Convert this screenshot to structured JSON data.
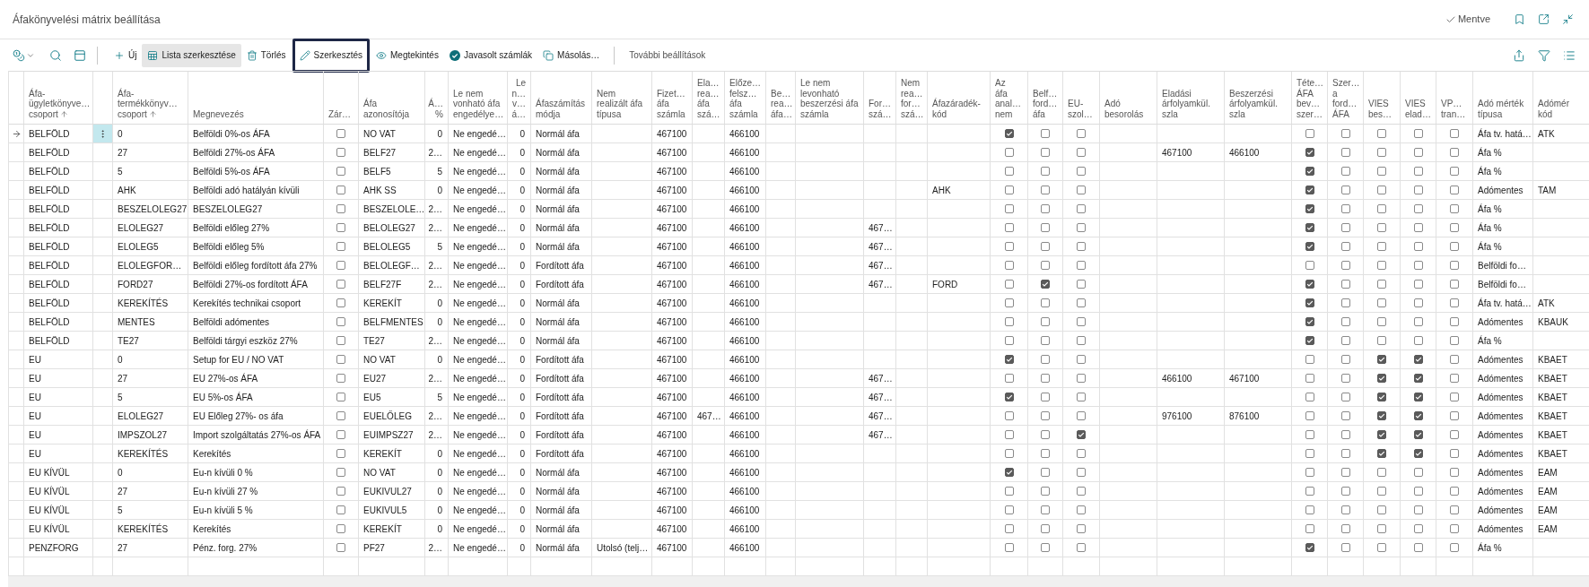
{
  "page": {
    "title": "Áfakönyvelési mátrix beállítása",
    "save_status": "Mentve"
  },
  "toolbar": {
    "actions": [
      {
        "label": "Új",
        "active": false,
        "focused": false
      },
      {
        "label": "Lista szerkesztése",
        "active": true,
        "focused": false
      },
      {
        "label": "Törlés",
        "active": false,
        "focused": false
      },
      {
        "label": "Szerkesztés",
        "active": false,
        "focused": true
      },
      {
        "label": "Megtekintés",
        "active": false,
        "focused": false
      },
      {
        "label": "Javasolt számlák",
        "active": false,
        "focused": false
      },
      {
        "label": "Másolás…",
        "active": false,
        "focused": false
      }
    ],
    "more": "További beállítások"
  },
  "table": {
    "columns": [
      {
        "label": "Áfa-\nügyletkönyve…\ncsoport",
        "kind": "text",
        "sorted": true
      },
      {
        "label": "Áfa-\ntermékkönyv…\ncsoport",
        "kind": "text",
        "sorted": true
      },
      {
        "label": "Megnevezés",
        "kind": "text",
        "sorted": false
      },
      {
        "label": "Zár…",
        "kind": "check",
        "sorted": false
      },
      {
        "label": "Áfa\nazonosítója",
        "kind": "text",
        "sorted": false
      },
      {
        "label": "Á…\n%",
        "kind": "number",
        "sorted": false
      },
      {
        "label": "Le nem\nvonható áfa\nengedélye…",
        "kind": "text",
        "sorted": false
      },
      {
        "label": "Le\nn…\nv…\ná…",
        "kind": "number",
        "sorted": false
      },
      {
        "label": "Áfaszámítás\nmódja",
        "kind": "text",
        "sorted": false
      },
      {
        "label": "Nem\nrealizált áfa\ntípusa",
        "kind": "text",
        "sorted": false
      },
      {
        "label": "Fizet…\náfa\nszámla",
        "kind": "text",
        "sorted": false
      },
      {
        "label": "Ela…\nrea…\náfa\nszá…",
        "kind": "text",
        "sorted": false
      },
      {
        "label": "Előze…\nfelsz…\náfa\nszámla",
        "kind": "text",
        "sorted": false
      },
      {
        "label": "Be…\nrea…\náfa…",
        "kind": "text",
        "sorted": false
      },
      {
        "label": "Le nem\nlevonható\nbeszerzési áfa\nszámla",
        "kind": "text",
        "sorted": false
      },
      {
        "label": "For…\nszá…",
        "kind": "text",
        "sorted": false
      },
      {
        "label": "Nem\nrea…\nfor…\nszá…",
        "kind": "text",
        "sorted": false
      },
      {
        "label": "Áfazáradék-\nkód",
        "kind": "text",
        "sorted": false
      },
      {
        "label": "Az\náfa\nanal…\nnem",
        "kind": "check",
        "sorted": false
      },
      {
        "label": "Belf…\nford…\náfa",
        "kind": "check",
        "sorted": false
      },
      {
        "label": "EU-\nszol…",
        "kind": "check",
        "sorted": false
      },
      {
        "label": "Adó\nbesorolás",
        "kind": "text",
        "sorted": false
      },
      {
        "label": "Eladási\nárfolyamkül.\nszla",
        "kind": "text",
        "sorted": false
      },
      {
        "label": "Beszerzési\nárfolyamkül.\nszla",
        "kind": "text",
        "sorted": false
      },
      {
        "label": "Téte…\nÁFA\nbev…\nszer…",
        "kind": "check",
        "sorted": false
      },
      {
        "label": "Szer…\na\nford…\nÁFA",
        "kind": "check",
        "sorted": false
      },
      {
        "label": "VIES\nbes…",
        "kind": "check",
        "sorted": false
      },
      {
        "label": "VIES\nelad…",
        "kind": "check",
        "sorted": false
      },
      {
        "label": "VP…\ntran…",
        "kind": "check",
        "sorted": false
      },
      {
        "label": "Adó mérték\ntípusa",
        "kind": "text",
        "sorted": false
      },
      {
        "label": "Adómér\nkód",
        "kind": "text",
        "sorted": false
      }
    ],
    "rows": [
      {
        "selected": true,
        "cells": [
          "BELFÖLD",
          "0",
          "Belföldi 0%-os ÁFA",
          false,
          "NO VAT",
          "0",
          "Ne engedé…",
          "0",
          "Normál áfa",
          null,
          "467100",
          null,
          "466100",
          null,
          null,
          null,
          null,
          null,
          true,
          false,
          false,
          null,
          null,
          null,
          false,
          false,
          false,
          false,
          false,
          "Áfa tv. hatá…",
          "ATK"
        ]
      },
      {
        "selected": false,
        "cells": [
          "BELFÖLD",
          "27",
          "Belföldi 27%-os ÁFA",
          false,
          "BELF27",
          "2…",
          "Ne engedé…",
          "0",
          "Normál áfa",
          null,
          "467100",
          null,
          "466100",
          null,
          null,
          null,
          null,
          null,
          false,
          false,
          false,
          null,
          "467100",
          "466100",
          true,
          false,
          false,
          false,
          false,
          "Áfa %",
          null
        ]
      },
      {
        "selected": false,
        "cells": [
          "BELFÖLD",
          "5",
          "Belföldi 5%-os ÁFA",
          false,
          "BELF5",
          "5",
          "Ne engedé…",
          "0",
          "Normál áfa",
          null,
          "467100",
          null,
          "466100",
          null,
          null,
          null,
          null,
          null,
          false,
          false,
          false,
          null,
          null,
          null,
          true,
          false,
          false,
          false,
          false,
          "Áfa %",
          null
        ]
      },
      {
        "selected": false,
        "cells": [
          "BELFÖLD",
          "AHK",
          "Belföldi adó hatályán kívüli",
          false,
          "AHK SS",
          "0",
          "Ne engedé…",
          "0",
          "Normál áfa",
          null,
          "467100",
          null,
          "466100",
          null,
          null,
          null,
          null,
          "AHK",
          false,
          false,
          false,
          null,
          null,
          null,
          true,
          false,
          false,
          false,
          false,
          "Adómentes",
          "TAM"
        ]
      },
      {
        "selected": false,
        "cells": [
          "BELFÖLD",
          "BESZELOLEG27",
          "BESZELOLEG27",
          false,
          "BESZELOLE…",
          "2…",
          "Ne engedé…",
          "0",
          "Normál áfa",
          null,
          "467100",
          null,
          "466100",
          null,
          null,
          null,
          null,
          null,
          false,
          false,
          false,
          null,
          null,
          null,
          true,
          false,
          false,
          false,
          false,
          "Áfa %",
          null
        ]
      },
      {
        "selected": false,
        "cells": [
          "BELFÖLD",
          "ELOLEG27",
          "Belföldi előleg 27%",
          false,
          "BELOLEG27",
          "2…",
          "Ne engedé…",
          "0",
          "Normál áfa",
          null,
          "467100",
          null,
          "466100",
          null,
          null,
          "467…",
          null,
          null,
          false,
          false,
          false,
          null,
          null,
          null,
          true,
          false,
          false,
          false,
          false,
          "Áfa %",
          null
        ]
      },
      {
        "selected": false,
        "cells": [
          "BELFÖLD",
          "ELOLEG5",
          "Belföldi előleg 5%",
          false,
          "BELOLEG5",
          "5",
          "Ne engedé…",
          "0",
          "Normál áfa",
          null,
          "467100",
          null,
          "466100",
          null,
          null,
          "467…",
          null,
          null,
          false,
          false,
          false,
          null,
          null,
          null,
          true,
          false,
          false,
          false,
          false,
          "Áfa %",
          null
        ]
      },
      {
        "selected": false,
        "cells": [
          "BELFÖLD",
          "ELOLEGFOR…",
          "Belföldi előleg fordított áfa 27%",
          false,
          "BELOLEGF…",
          "2…",
          "Ne engedé…",
          "0",
          "Fordított áfa",
          null,
          "467100",
          null,
          "466100",
          null,
          null,
          "467…",
          null,
          null,
          false,
          false,
          false,
          null,
          null,
          null,
          false,
          false,
          false,
          false,
          false,
          "Belföldi fo…",
          null
        ]
      },
      {
        "selected": false,
        "cells": [
          "BELFÖLD",
          "FORD27",
          "Belföldi 27%-os fordított ÁFA",
          false,
          "BELF27F",
          "2…",
          "Ne engedé…",
          "0",
          "Fordított áfa",
          null,
          "467100",
          null,
          "466100",
          null,
          null,
          "467…",
          null,
          "FORD",
          false,
          true,
          false,
          null,
          null,
          null,
          true,
          false,
          false,
          false,
          false,
          "Belföldi fo…",
          null
        ]
      },
      {
        "selected": false,
        "cells": [
          "BELFÖLD",
          "KEREKÍTÉS",
          "Kerekítés technikai csoport",
          false,
          "KEREKÍT",
          "0",
          "Ne engedé…",
          "0",
          "Normál áfa",
          null,
          "467100",
          null,
          "466100",
          null,
          null,
          null,
          null,
          null,
          false,
          false,
          false,
          null,
          null,
          null,
          true,
          false,
          false,
          false,
          false,
          "Áfa tv. hatá…",
          "ATK"
        ]
      },
      {
        "selected": false,
        "cells": [
          "BELFÖLD",
          "MENTES",
          "Belföldi adómentes",
          false,
          "BELFMENTES",
          "0",
          "Ne engedé…",
          "0",
          "Normál áfa",
          null,
          "467100",
          null,
          "466100",
          null,
          null,
          null,
          null,
          null,
          false,
          false,
          false,
          null,
          null,
          null,
          true,
          false,
          false,
          false,
          false,
          "Adómentes",
          "KBAUK"
        ]
      },
      {
        "selected": false,
        "cells": [
          "BELFÖLD",
          "TE27",
          "Belföldi tárgyi eszköz 27%",
          false,
          "TE27",
          "2…",
          "Ne engedé…",
          "0",
          "Normál áfa",
          null,
          "467100",
          null,
          "466100",
          null,
          null,
          null,
          null,
          null,
          false,
          false,
          false,
          null,
          null,
          null,
          true,
          false,
          false,
          false,
          false,
          "Áfa %",
          null
        ]
      },
      {
        "selected": false,
        "cells": [
          "EU",
          "0",
          "Setup for EU / NO VAT",
          false,
          "NO VAT",
          "0",
          "Ne engedé…",
          "0",
          "Fordított áfa",
          null,
          "467100",
          null,
          "466100",
          null,
          null,
          null,
          null,
          null,
          true,
          false,
          false,
          null,
          null,
          null,
          false,
          false,
          true,
          true,
          false,
          "Adómentes",
          "KBAET"
        ]
      },
      {
        "selected": false,
        "cells": [
          "EU",
          "27",
          "EU 27%-os ÁFA",
          false,
          "EU27",
          "2…",
          "Ne engedé…",
          "0",
          "Fordított áfa",
          null,
          "467100",
          null,
          "466100",
          null,
          null,
          "467…",
          null,
          null,
          false,
          false,
          false,
          null,
          "466100",
          "467100",
          false,
          false,
          true,
          true,
          false,
          "Adómentes",
          "KBAET"
        ]
      },
      {
        "selected": false,
        "cells": [
          "EU",
          "5",
          "EU 5%-os ÁFA",
          false,
          "EU5",
          "5",
          "Ne engedé…",
          "0",
          "Fordított áfa",
          null,
          "467100",
          null,
          "466100",
          null,
          null,
          "467…",
          null,
          null,
          true,
          false,
          false,
          null,
          null,
          null,
          false,
          false,
          true,
          true,
          false,
          "Adómentes",
          "KBAET"
        ]
      },
      {
        "selected": false,
        "cells": [
          "EU",
          "ELOLEG27",
          "EU Előleg 27%- os áfa",
          false,
          "EUELŐLEG",
          "2…",
          "Ne engedé…",
          "0",
          "Fordított áfa",
          null,
          "467100",
          "467…",
          "466100",
          null,
          null,
          "467…",
          null,
          null,
          false,
          false,
          false,
          null,
          "976100",
          "876100",
          false,
          false,
          true,
          true,
          false,
          "Adómentes",
          "KBAET"
        ]
      },
      {
        "selected": false,
        "cells": [
          "EU",
          "IMPSZOL27",
          "Import szolgáltatás 27%-os ÁFA",
          false,
          "EUIMPSZ27",
          "2…",
          "Ne engedé…",
          "0",
          "Fordított áfa",
          null,
          "467100",
          null,
          "466100",
          null,
          null,
          "467…",
          null,
          null,
          false,
          false,
          true,
          null,
          null,
          null,
          false,
          false,
          true,
          true,
          false,
          "Adómentes",
          "KBAET"
        ]
      },
      {
        "selected": false,
        "cells": [
          "EU",
          "KEREKÍTÉS",
          "Kerekítés",
          false,
          "KEREKÍT",
          "0",
          "Ne engedé…",
          "0",
          "Fordított áfa",
          null,
          "467100",
          null,
          "466100",
          null,
          null,
          null,
          null,
          null,
          false,
          false,
          false,
          null,
          null,
          null,
          false,
          false,
          true,
          true,
          false,
          "Adómentes",
          "KBAET"
        ]
      },
      {
        "selected": false,
        "cells": [
          "EU KÍVÜL",
          "0",
          "Eu-n kívüli 0 %",
          false,
          "NO VAT",
          "0",
          "Ne engedé…",
          "0",
          "Normál áfa",
          null,
          "467100",
          null,
          "466100",
          null,
          null,
          null,
          null,
          null,
          true,
          false,
          false,
          null,
          null,
          null,
          false,
          false,
          false,
          false,
          false,
          "Adómentes",
          "EAM"
        ]
      },
      {
        "selected": false,
        "cells": [
          "EU KÍVÜL",
          "27",
          "Eu-n kívüli 27 %",
          false,
          "EUKIVUL27",
          "0",
          "Ne engedé…",
          "0",
          "Normál áfa",
          null,
          "467100",
          null,
          "466100",
          null,
          null,
          null,
          null,
          null,
          false,
          false,
          false,
          null,
          null,
          null,
          false,
          false,
          false,
          false,
          false,
          "Adómentes",
          "EAM"
        ]
      },
      {
        "selected": false,
        "cells": [
          "EU KÍVÜL",
          "5",
          "Eu-n kívüli 5 %",
          false,
          "EUKIVUL5",
          "0",
          "Ne engedé…",
          "0",
          "Normál áfa",
          null,
          "467100",
          null,
          "466100",
          null,
          null,
          null,
          null,
          null,
          false,
          false,
          false,
          null,
          null,
          null,
          false,
          false,
          false,
          false,
          false,
          "Adómentes",
          "EAM"
        ]
      },
      {
        "selected": false,
        "cells": [
          "EU KÍVÜL",
          "KEREKÍTÉS",
          "Kerekítés",
          false,
          "KEREKÍT",
          "0",
          "Ne engedé…",
          "0",
          "Normál áfa",
          null,
          "467100",
          null,
          "466100",
          null,
          null,
          null,
          null,
          null,
          false,
          false,
          false,
          null,
          null,
          null,
          false,
          false,
          false,
          false,
          false,
          "Adómentes",
          "EAM"
        ]
      },
      {
        "selected": false,
        "cells": [
          "PENZFORG",
          "27",
          "Pénz. forg. 27%",
          false,
          "PF27",
          "2…",
          "Ne engedé…",
          "0",
          "Normál áfa",
          "Utolsó (telj…",
          "467100",
          null,
          "466100",
          null,
          null,
          null,
          null,
          null,
          false,
          false,
          false,
          null,
          null,
          null,
          true,
          false,
          false,
          false,
          false,
          "Áfa %",
          null
        ]
      }
    ]
  }
}
